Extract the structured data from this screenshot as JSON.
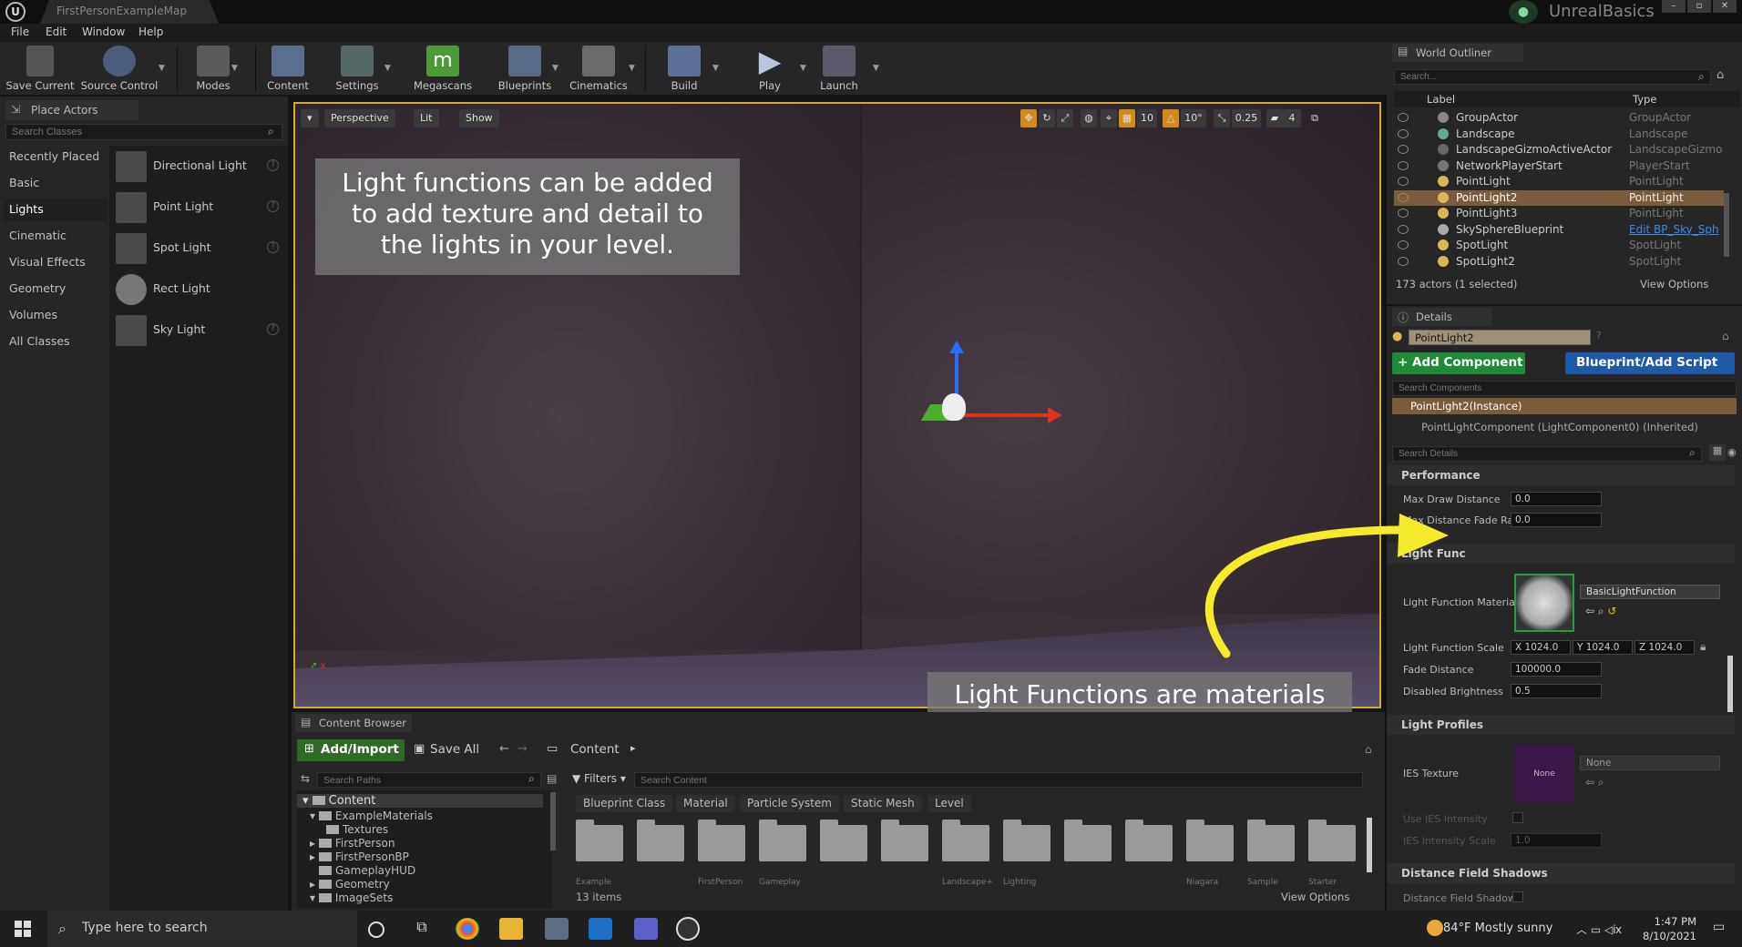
{
  "window": {
    "tab_title": "FirstPersonExampleMap",
    "project_name": "UnrealBasics"
  },
  "menu": [
    "File",
    "Edit",
    "Window",
    "Help"
  ],
  "toolbar": [
    "Save Current",
    "Source Control",
    "Modes",
    "Content",
    "Settings",
    "Megascans",
    "Blueprints",
    "Cinematics",
    "Build",
    "Play",
    "Launch"
  ],
  "place_actors": {
    "tab": "Place Actors",
    "search_placeholder": "Search Classes",
    "categories": [
      "Recently Placed",
      "Basic",
      "Lights",
      "Cinematic",
      "Visual Effects",
      "Geometry",
      "Volumes",
      "All Classes"
    ],
    "selected_category": "Lights",
    "items": [
      "Directional Light",
      "Point Light",
      "Spot Light",
      "Rect Light",
      "Sky Light"
    ]
  },
  "viewport": {
    "view_mode": "Perspective",
    "lighting": "Lit",
    "show": "Show",
    "grid_snap": "10",
    "rot_snap": "10°",
    "scale_snap": "0.25",
    "camera_speed": "4"
  },
  "callouts": {
    "top": "Light functions can be added to add texture and detail to the lights in your level.",
    "bottom": "Light Functions are materials that are applied onto a light from the details panel."
  },
  "outliner": {
    "tab": "World Outliner",
    "search_placeholder": "Search...",
    "col_label": "Label",
    "col_type": "Type",
    "rows": [
      {
        "label": "GroupActor",
        "type": "GroupActor"
      },
      {
        "label": "Landscape",
        "type": "Landscape"
      },
      {
        "label": "LandscapeGizmoActiveActor",
        "type": "LandscapeGizmoA"
      },
      {
        "label": "NetworkPlayerStart",
        "type": "PlayerStart"
      },
      {
        "label": "PointLight",
        "type": "PointLight"
      },
      {
        "label": "PointLight2",
        "type": "PointLight"
      },
      {
        "label": "PointLight3",
        "type": "PointLight"
      },
      {
        "label": "SkySphereBlueprint",
        "type": "Edit BP_Sky_Sph"
      },
      {
        "label": "SpotLight",
        "type": "SpotLight"
      },
      {
        "label": "SpotLight2",
        "type": "SpotLight"
      }
    ],
    "selected_row": "PointLight2",
    "count": "173 actors (1 selected)",
    "view_options": "View Options"
  },
  "details": {
    "tab": "Details",
    "actor_name": "PointLight2",
    "add_component": "+ Add Component",
    "blueprint_script": "Blueprint/Add Script",
    "search_components": "Search Components",
    "instance": "PointLight2(Instance)",
    "component": "PointLightComponent (LightComponent0) (Inherited)",
    "search_details": "Search Details",
    "sections": {
      "performance": "Performance",
      "light_function": "Light Func",
      "light_profiles": "Light Profiles",
      "dfs": "Distance Field Shadows"
    },
    "props": {
      "max_draw_distance": {
        "label": "Max Draw Distance",
        "value": "0.0"
      },
      "max_distance_fade": {
        "label": "Max Distance Fade Ra",
        "value": "0.0"
      },
      "lf_material": {
        "label": "Light Function Materia",
        "value": "BasicLightFunction"
      },
      "lf_scale": {
        "label": "Light Function Scale",
        "x": "X 1024.0",
        "y": "Y 1024.0",
        "z": "Z 1024.0"
      },
      "fade_distance": {
        "label": "Fade Distance",
        "value": "100000.0"
      },
      "disabled_brightness": {
        "label": "Disabled Brightness",
        "value": "0.5"
      },
      "ies_texture": {
        "label": "IES Texture",
        "thumb": "None",
        "value": "None"
      },
      "use_ies": {
        "label": "Use IES Intensity"
      },
      "ies_scale": {
        "label": "IES Intensity Scale",
        "value": "1.0"
      },
      "dfs_shadow": {
        "label": "Distance Field Shadow"
      }
    }
  },
  "content_browser": {
    "tab": "Content Browser",
    "add_import": "Add/Import",
    "save_all": "Save All",
    "breadcrumb": "Content",
    "search_paths": "Search Paths",
    "filters": "Filters",
    "search_content": "Search Content",
    "tree": [
      "Content",
      "ExampleMaterials",
      "Textures",
      "FirstPerson",
      "FirstPersonBP",
      "GameplayHUD",
      "Geometry",
      "ImageSets"
    ],
    "filter_chips": [
      "Blueprint Class",
      "Material",
      "Particle System",
      "Static Mesh",
      "Level"
    ],
    "folder_labels": [
      "Example",
      "",
      "FirstPerson",
      "Gameplay",
      "",
      "",
      "Landscape+",
      "Lighting",
      "",
      "",
      "Niagara",
      "Sample",
      "Starter"
    ],
    "count": "13 items",
    "view_options": "View Options"
  },
  "taskbar": {
    "search_placeholder": "Type here to search",
    "weather": "84°F  Mostly sunny",
    "time": "1:47 PM",
    "date": "8/10/2021"
  }
}
